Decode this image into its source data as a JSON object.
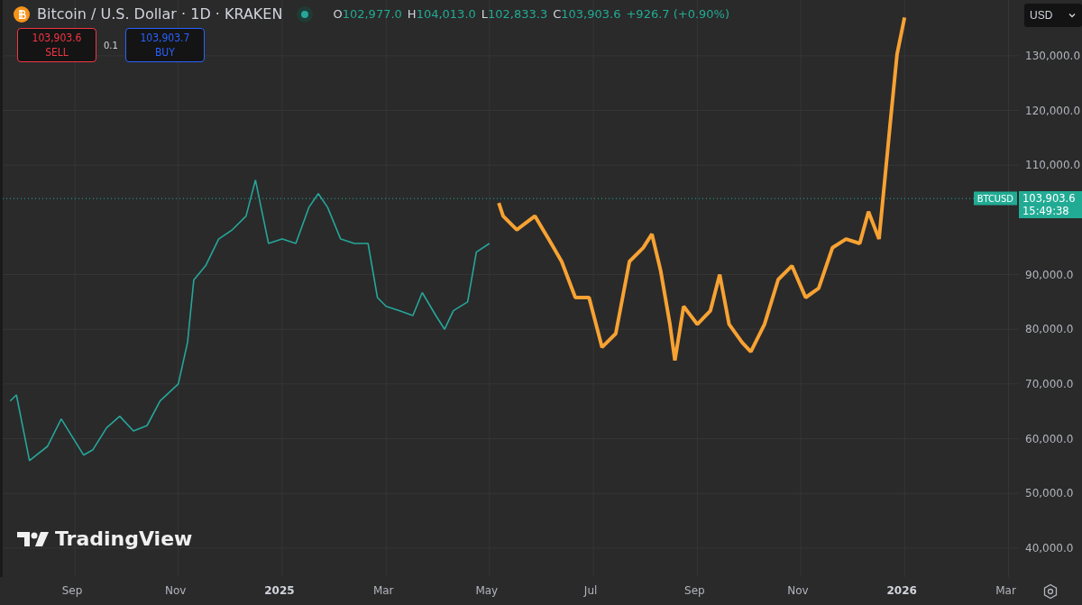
{
  "header": {
    "symbol": "Bitcoin / U.S. Dollar · 1D · KRAKEN",
    "market_open": true,
    "ohlc": [
      {
        "label": "O",
        "value": "102,977.0"
      },
      {
        "label": "H",
        "value": "104,013.0"
      },
      {
        "label": "L",
        "value": "102,833.3"
      },
      {
        "label": "C",
        "value": "103,903.6"
      }
    ],
    "change": "+926.7 (+0.90%)"
  },
  "trade": {
    "sell": {
      "price": "103,903.6",
      "label": "SELL"
    },
    "quantity": "0.1",
    "buy": {
      "price": "103,903.7",
      "label": "BUY"
    }
  },
  "currency": "USD",
  "price_tag": {
    "price": "103,903.6",
    "countdown": "15:49:38"
  },
  "logo": "TradingView",
  "chart_data": {
    "type": "line",
    "xlim": [
      2024.551,
      2026.188
    ],
    "ylim": [
      34700,
      140200
    ],
    "x": [
      2024.563,
      2024.573,
      2024.594,
      2024.623,
      2024.645,
      2024.681,
      2024.696,
      2024.718,
      2024.739,
      2024.761,
      2024.783,
      2024.804,
      2024.833,
      2024.848,
      2024.858,
      2024.877,
      2024.898,
      2024.92,
      2024.942,
      2024.957,
      2024.978,
      2025.0,
      2025.022,
      2025.043,
      2025.058,
      2025.073,
      2025.094,
      2025.116,
      2025.138,
      2025.153,
      2025.167,
      2025.188,
      2025.21,
      2025.225,
      2025.247,
      2025.261,
      2025.275,
      2025.298,
      2025.312,
      2025.333,
      2025.348,
      2025.355,
      2025.377,
      2025.406,
      2025.428,
      2025.449,
      2025.471,
      2025.493,
      2025.514,
      2025.536,
      2025.558,
      2025.58,
      2025.594,
      2025.608,
      2025.623,
      2025.631,
      2025.645,
      2025.667,
      2025.688,
      2025.703,
      2025.718,
      2025.739,
      2025.753,
      2025.775,
      2025.797,
      2025.819,
      2025.841,
      2025.862,
      2025.884,
      2025.906,
      2025.928,
      2025.942,
      2025.959,
      2025.971,
      2025.978,
      2025.988,
      2026.0
    ],
    "series": [
      {
        "name": "BTCUSD",
        "color": "#26a69a",
        "values": [
          66900,
          68000,
          56000,
          58600,
          63600,
          57000,
          58000,
          62000,
          64100,
          61400,
          62400,
          66900,
          70000,
          77600,
          89000,
          91600,
          96500,
          98200,
          100700,
          107300,
          95700,
          96500,
          95700,
          102300,
          104800,
          102300,
          96500,
          95700,
          95700,
          85800,
          84200,
          83400,
          82500,
          86700,
          82500,
          80000,
          83400,
          85000,
          94100,
          95700,
          null,
          null,
          null,
          null,
          null,
          null,
          null,
          null,
          null,
          null,
          null,
          null,
          null,
          null,
          null,
          null,
          null,
          null,
          null,
          null,
          null,
          null,
          null,
          null,
          null,
          null,
          null,
          null,
          null,
          null,
          null,
          null,
          null,
          null,
          null,
          null,
          null
        ]
      },
      {
        "color": "#f7a233",
        "values": [
          null,
          null,
          null,
          null,
          null,
          null,
          null,
          null,
          null,
          null,
          null,
          null,
          null,
          null,
          null,
          null,
          null,
          null,
          null,
          null,
          null,
          null,
          null,
          null,
          null,
          null,
          null,
          null,
          null,
          null,
          null,
          null,
          null,
          null,
          null,
          null,
          null,
          null,
          null,
          null,
          103100,
          100700,
          98200,
          100700,
          96500,
          92400,
          85800,
          85800,
          76700,
          79200,
          92400,
          94900,
          97400,
          90800,
          80900,
          74300,
          84200,
          80900,
          83400,
          90000,
          80900,
          77600,
          75900,
          80900,
          89100,
          91600,
          85800,
          87500,
          94900,
          96500,
          95700,
          101500,
          96500,
          110600,
          118800,
          130300,
          137000
        ]
      }
    ],
    "xticks": [
      {
        "value": 2024.667,
        "label": "Sep"
      },
      {
        "value": 2024.833,
        "label": "Nov"
      },
      {
        "value": 2025,
        "label": "2025"
      },
      {
        "value": 2025.167,
        "label": "Mar"
      },
      {
        "value": 2025.333,
        "label": "May"
      },
      {
        "value": 2025.5,
        "label": "Jul"
      },
      {
        "value": 2025.667,
        "label": "Sep"
      },
      {
        "value": 2025.833,
        "label": "Nov"
      },
      {
        "value": 2026,
        "label": "2026"
      },
      {
        "value": 2026.167,
        "label": "Mar"
      }
    ],
    "yticks": [
      {
        "value": 40000,
        "label": "40,000.0"
      },
      {
        "value": 50000,
        "label": "50,000.0"
      },
      {
        "value": 60000,
        "label": "60,000.0"
      },
      {
        "value": 70000,
        "label": "70,000.0"
      },
      {
        "value": 80000,
        "label": "80,000.0"
      },
      {
        "value": 90000,
        "label": "90,000.0"
      },
      {
        "value": 110000,
        "label": "110,000.0"
      },
      {
        "value": 120000,
        "label": "120,000.0"
      },
      {
        "value": 130000,
        "label": "130,000.0"
      }
    ],
    "grid": true,
    "ref_lines": [
      {
        "axis": "y",
        "value": 103903.6
      }
    ]
  }
}
